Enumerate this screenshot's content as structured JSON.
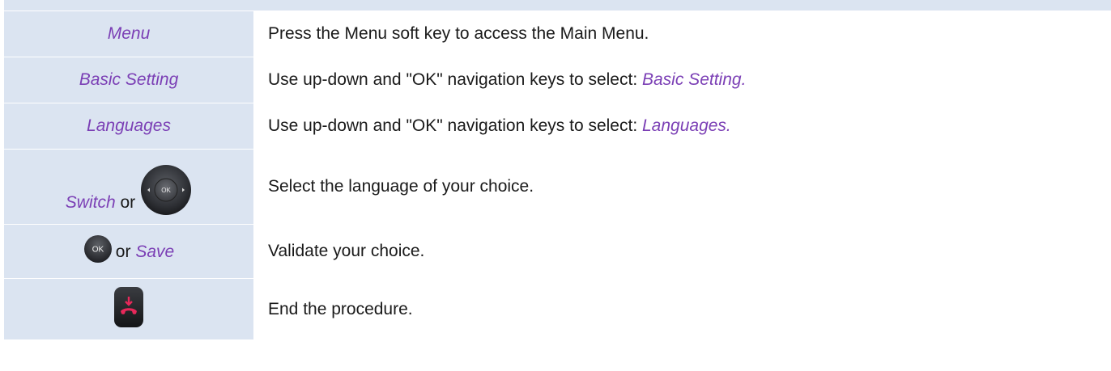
{
  "rows": [
    {
      "key": "Menu",
      "description": "Press the Menu soft key to access the Main Menu."
    },
    {
      "key": "Basic Setting",
      "description_prefix": "Use up-down and \"OK\" navigation keys to select: ",
      "description_accent": "Basic Setting."
    },
    {
      "key": "Languages",
      "description_prefix": "Use up-down and \"OK\" navigation keys to select: ",
      "description_accent": "Languages."
    },
    {
      "key": "Switch",
      "connector": "or",
      "icon": "navigation-pad-icon",
      "icon_label": "OK",
      "description": "Select the language of your choice."
    },
    {
      "icon": "ok-button-icon",
      "icon_label": "OK",
      "connector": "or",
      "key": "Save",
      "description": "Validate your choice."
    },
    {
      "icon": "hang-up-key-icon",
      "description": "End the procedure."
    }
  ],
  "colors": {
    "key_column_bg": "#dbe4f1",
    "accent_text": "#7b3fb5",
    "body_text": "#1a1a1a",
    "hangup_red": "#e8285a"
  }
}
